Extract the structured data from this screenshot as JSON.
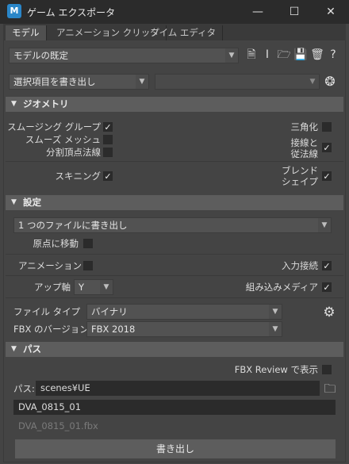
{
  "window": {
    "title": "ゲーム エクスポータ",
    "app_icon_letter": "M",
    "minimize": "—",
    "maximize": "☐",
    "close": "✕"
  },
  "tabs": [
    "モデル",
    "アニメーション クリップ",
    "タイム エディタ"
  ],
  "preset": {
    "value": "モデルの既定"
  },
  "toolbar_icons": [
    "add-preset-icon",
    "rename-preset-icon",
    "open-folder-icon",
    "save-icon",
    "delete-icon",
    "help-icon"
  ],
  "export_mode": {
    "value": "選択項目を書き出し",
    "secondary_value": ""
  },
  "sections": {
    "geometry": "ジオメトリ",
    "settings": "設定",
    "path": "パス"
  },
  "geometry": {
    "smoothing_groups": {
      "label": "スムージング グループ",
      "checked": true
    },
    "smooth_mesh": {
      "label": "スムーズ メッシュ",
      "checked": false
    },
    "split_vertex_normals": {
      "label": "分割頂点法線",
      "checked": false
    },
    "triangulate": {
      "label": "三角化",
      "checked": false
    },
    "tangents_line1": "接線と",
    "tangents_line2": "従法線",
    "tangents_checked": true,
    "skinning": {
      "label": "スキニング",
      "checked": true
    },
    "blendshapes_line1": "ブレンド",
    "blendshapes_line2": "シェイプ",
    "blendshapes_checked": true
  },
  "settings": {
    "file_mode": "1 つのファイルに書き出し",
    "move_to_origin": {
      "label": "原点に移動",
      "checked": false
    },
    "animation": {
      "label": "アニメーション",
      "checked": false
    },
    "input_connections": {
      "label": "入力接続",
      "checked": true
    },
    "up_axis_label": "アップ軸",
    "up_axis_value": "Y",
    "embed_media": {
      "label": "組み込みメディア",
      "checked": true
    },
    "file_type_label": "ファイル タイプ",
    "file_type_value": "バイナリ",
    "fbx_version_label": "FBX のバージョン",
    "fbx_version_value": "FBX 2018"
  },
  "path": {
    "fbx_review": {
      "label": "FBX Review で表示",
      "checked": false
    },
    "path_label": "パス:",
    "path_value": "scenes¥UE",
    "file_name": "DVA_0815_01",
    "file_preview": "DVA_0815_01.fbx"
  },
  "export_button": "書き出し",
  "check_mark": "✓"
}
